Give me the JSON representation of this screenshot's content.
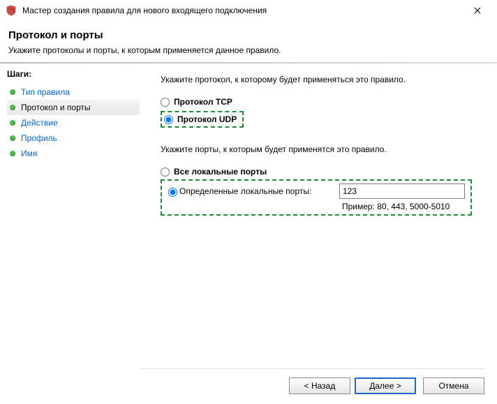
{
  "window": {
    "title": "Мастер создания правила для нового входящего подключения",
    "close_tooltip": "Закрыть"
  },
  "header": {
    "title": "Протокол и порты",
    "subtitle": "Укажите протоколы и порты, к которым применяется данное правило."
  },
  "sidebar": {
    "label": "Шаги:",
    "items": [
      {
        "label": "Тип правила"
      },
      {
        "label": "Протокол и порты"
      },
      {
        "label": "Действие"
      },
      {
        "label": "Профиль"
      },
      {
        "label": "Имя"
      }
    ],
    "current_index": 1
  },
  "content": {
    "protocol_intro": "Укажите протокол, к которому будет применяться это правило.",
    "opt_tcp": "Протокол TCP",
    "opt_udp": "Протокол UDP",
    "protocol_selected": "udp",
    "ports_intro": "Укажите порты, к которым будет применятся это правило.",
    "opt_all_ports": "Все локальные порты",
    "opt_specific_ports": "Определенные локальные порты:",
    "ports_selected": "specific",
    "ports_value": "123",
    "ports_example": "Пример: 80, 443, 5000-5010"
  },
  "buttons": {
    "back": "< Назад",
    "next": "Далее >",
    "cancel": "Отмена"
  }
}
